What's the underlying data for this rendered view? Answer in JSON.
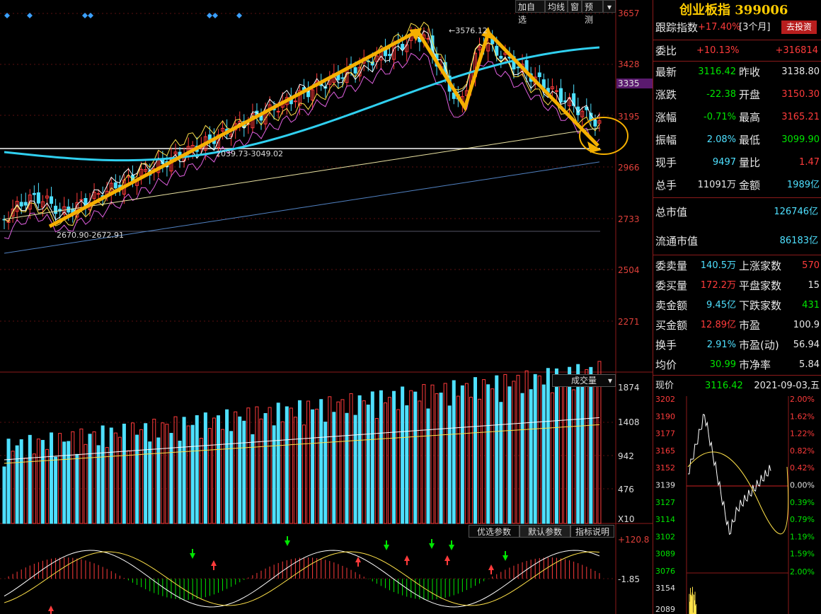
{
  "toolbar": {
    "add_watchlist": "加自选",
    "ma_line": "均线",
    "window": "窗",
    "forecast": "预测"
  },
  "price_axis": [
    "3657",
    "3428",
    "3335",
    "3195",
    "2966",
    "2733",
    "2504",
    "2271"
  ],
  "annotations": {
    "high_label": "3576.12",
    "mid_range": "2039.73-3049.02",
    "low_range": "2670.90-2672.91"
  },
  "volume": {
    "selector": "成交量",
    "axis": [
      "1874",
      "1408",
      "942",
      "476"
    ],
    "unit": "X10"
  },
  "indicator": {
    "tabs": [
      "优选参数",
      "默认参数",
      "指标说明"
    ],
    "axis": [
      "+120.8",
      "-1.85"
    ]
  },
  "panel": {
    "title": "创业板指 399006",
    "track_label": "跟踪指数",
    "track_value": "+17.40%",
    "track_period": "[3个月]",
    "invest_button": "去投资",
    "weibi_label": "委比",
    "weibi_pct": "+10.13%",
    "weibi_num": "+316814",
    "rows": [
      {
        "l1": "最新",
        "v1": "3116.42",
        "c1": "green",
        "l2": "昨收",
        "v2": "3138.80",
        "c2": "white"
      },
      {
        "l1": "涨跌",
        "v1": "-22.38",
        "c1": "green",
        "l2": "开盘",
        "v2": "3150.30",
        "c2": "red"
      },
      {
        "l1": "涨幅",
        "v1": "-0.71%",
        "c1": "green",
        "l2": "最高",
        "v2": "3165.21",
        "c2": "red"
      },
      {
        "l1": "振幅",
        "v1": "2.08%",
        "c1": "cyan",
        "l2": "最低",
        "v2": "3099.90",
        "c2": "green"
      },
      {
        "l1": "现手",
        "v1": "9497",
        "c1": "cyan",
        "l2": "量比",
        "v2": "1.47",
        "c2": "red"
      },
      {
        "l1": "总手",
        "v1": "11091万",
        "c1": "white",
        "l2": "金额",
        "v2": "1989亿",
        "c2": "cyan"
      }
    ],
    "total_mv_label": "总市值",
    "total_mv": "126746亿",
    "float_mv_label": "流通市值",
    "float_mv": "86183亿",
    "rows2": [
      {
        "l1": "委卖量",
        "v1": "140.5万",
        "c1": "cyan",
        "l2": "上涨家数",
        "v2": "570",
        "c2": "red"
      },
      {
        "l1": "委买量",
        "v1": "172.2万",
        "c1": "red",
        "l2": "平盘家数",
        "v2": "15",
        "c2": "white"
      },
      {
        "l1": "卖金额",
        "v1": "9.45亿",
        "c1": "cyan",
        "l2": "下跌家数",
        "v2": "431",
        "c2": "green"
      },
      {
        "l1": "买金额",
        "v1": "12.89亿",
        "c1": "red",
        "l2": "市盈",
        "v2": "100.9",
        "c2": "white"
      },
      {
        "l1": "换手",
        "v1": "2.91%",
        "c1": "cyan",
        "l2": "市盈(动)",
        "v2": "56.94",
        "c2": "white"
      },
      {
        "l1": "均价",
        "v1": "30.99",
        "c1": "green",
        "l2": "市净率",
        "v2": "5.84",
        "c2": "white"
      }
    ],
    "now_label": "现价",
    "now_value": "3116.42",
    "date": "2021-09-03,五",
    "mini_left": [
      "3202",
      "3190",
      "3177",
      "3165",
      "3152",
      "3139",
      "3127",
      "3114",
      "3102",
      "3089",
      "3076",
      "3154",
      "2089"
    ],
    "mini_right": [
      "2.00%",
      "1.62%",
      "1.22%",
      "0.82%",
      "0.42%",
      "0.00%",
      "0.39%",
      "0.79%",
      "1.19%",
      "1.59%",
      "2.00%"
    ]
  }
}
